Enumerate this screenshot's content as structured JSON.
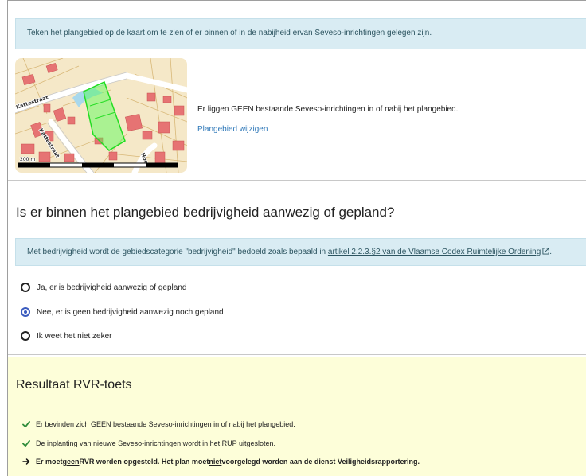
{
  "info_banner": "Teken het plangebied op de kaart om te zien of er binnen of in de nabijheid ervan Seveso-inrichtingen gelegen zijn.",
  "map": {
    "street_labels": [
      "Kattestraat",
      "Kattestraat",
      "Hoog"
    ],
    "scale_label": "200 m"
  },
  "map_result": "Er liggen GEEN bestaande Seveso-inrichtingen in of nabij het plangebied.",
  "change_link": "Plangebied wijzigen",
  "question": {
    "title": "Is er binnen het plangebied bedrijvigheid aanwezig of gepland?",
    "info_prefix": "Met bedrijvigheid wordt de gebiedscategorie \"bedrijvigheid\" bedoeld zoals bepaald in ",
    "info_link": "artikel 2.2.3.§2 van de Vlaamse Codex Ruimtelijke Ordening",
    "info_suffix": ".",
    "options": [
      {
        "label": "Ja, er is bedrijvigheid aanwezig of gepland",
        "checked": false
      },
      {
        "label": "Nee, er is geen bedrijvigheid aanwezig noch gepland",
        "checked": true
      },
      {
        "label": "Ik weet het niet zeker",
        "checked": false
      }
    ]
  },
  "result": {
    "title": "Resultaat RVR-toets",
    "item1": "Er bevinden zich GEEN bestaande Seveso-inrichtingen in of nabij het plangebied.",
    "item2": "De inplanting van nieuwe Seveso-inrichtingen wordt in het RUP uitgesloten.",
    "item3_a": "Er moet ",
    "item3_b": "geen",
    "item3_c": " RVR worden opgesteld. Het plan moet ",
    "item3_d": "niet",
    "item3_e": " voorgelegd worden aan de dienst Veiligheidsrapportering.",
    "check_color": "#2e8b3a"
  },
  "colors": {
    "info_bg": "#d9ecf3",
    "result_bg": "#fdfed9",
    "link": "#2d77b8",
    "radio_selected": "#3a5bbf"
  }
}
